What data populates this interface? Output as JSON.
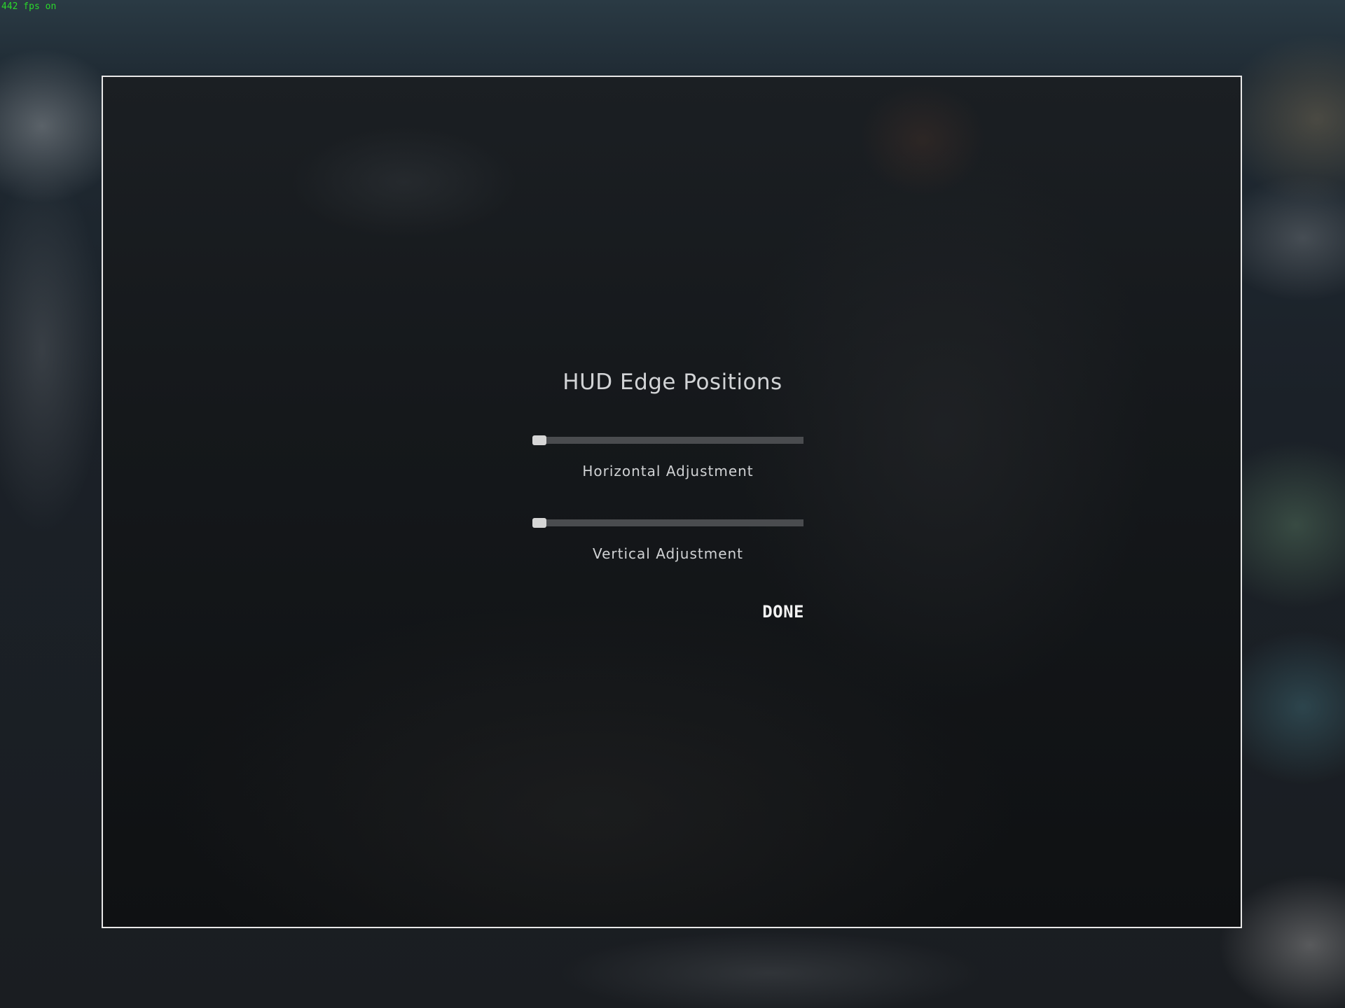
{
  "overlay": {
    "fps_text": "442 fps on"
  },
  "dialog": {
    "title": "HUD Edge Positions",
    "sliders": [
      {
        "label": "Horizontal Adjustment",
        "value": 0
      },
      {
        "label": "Vertical Adjustment",
        "value": 0
      }
    ],
    "done_label": "DONE"
  }
}
